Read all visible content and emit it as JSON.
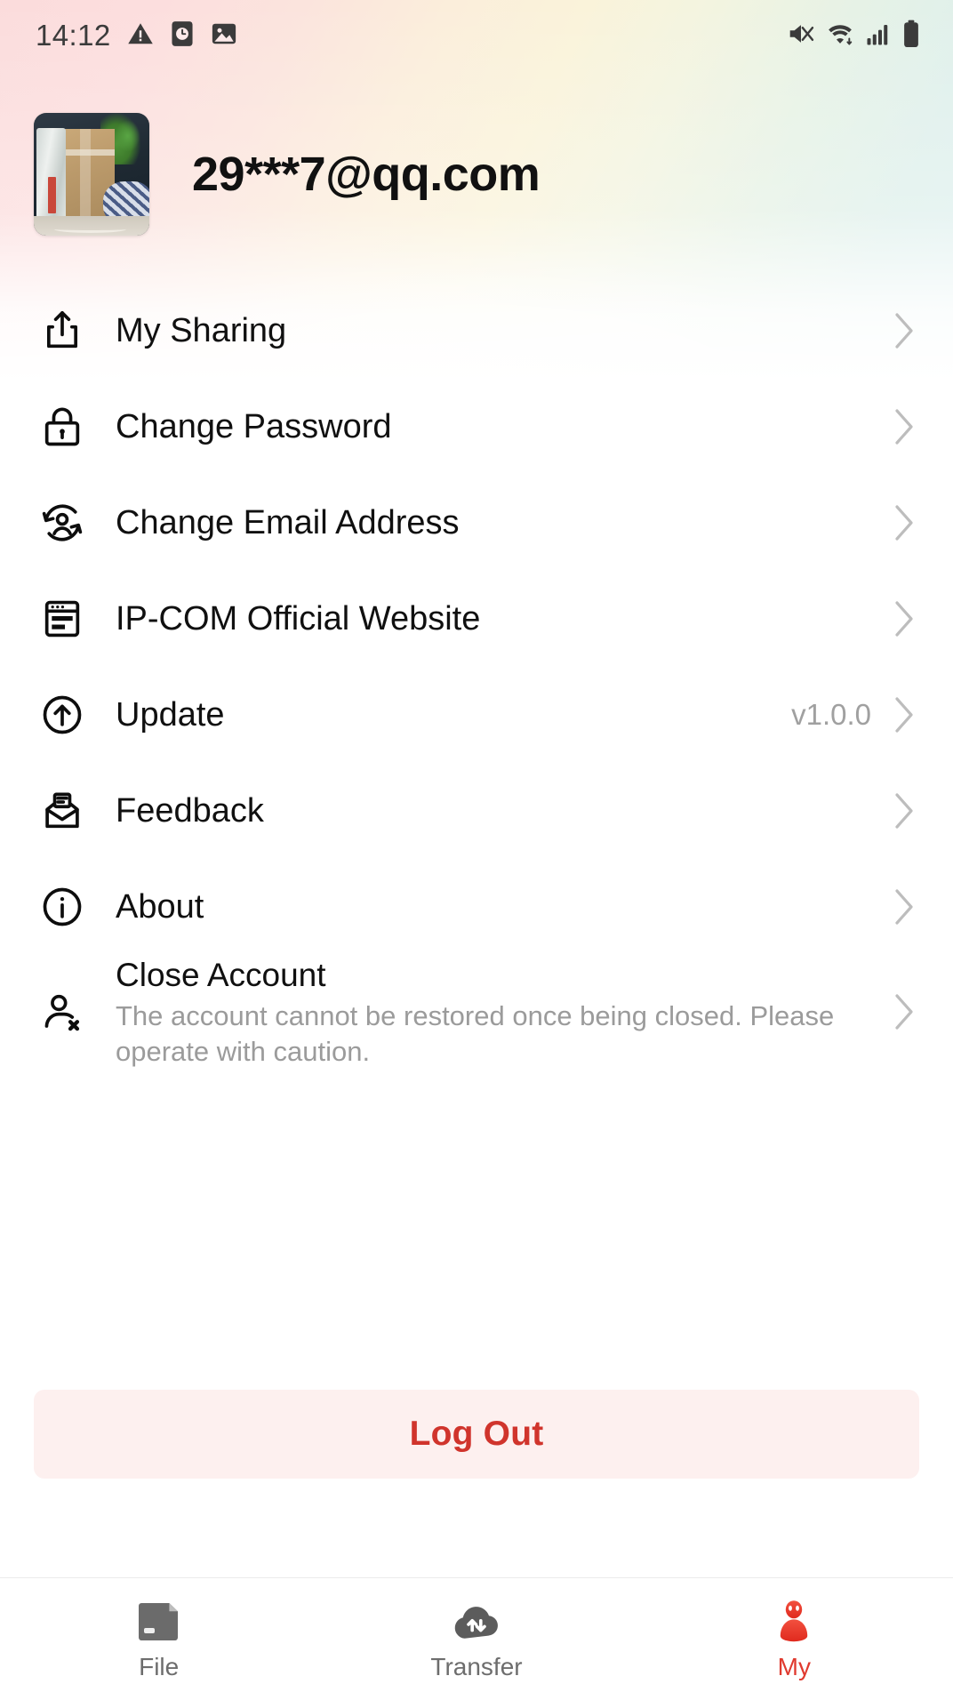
{
  "status_bar": {
    "time": "14:12",
    "left_icons": [
      "warning-triangle-icon",
      "alarm-clock-icon",
      "photo-icon"
    ],
    "right_icons": [
      "mute-vibrate-icon",
      "wifi-icon",
      "cellular-signal-icon",
      "battery-icon"
    ]
  },
  "profile": {
    "avatar_alt": "user-avatar-photo",
    "email": "29***7@qq.com"
  },
  "menu": {
    "items": [
      {
        "icon": "share-icon",
        "label": "My Sharing",
        "sub": "",
        "value": "",
        "chevron": true
      },
      {
        "icon": "lock-icon",
        "label": "Change Password",
        "sub": "",
        "value": "",
        "chevron": true
      },
      {
        "icon": "switch-account-icon",
        "label": "Change Email Address",
        "sub": "",
        "value": "",
        "chevron": true
      },
      {
        "icon": "browser-window-icon",
        "label": "IP-COM Official Website",
        "sub": "",
        "value": "",
        "chevron": true
      },
      {
        "icon": "update-arrow-icon",
        "label": "Update",
        "sub": "",
        "value": "v1.0.0",
        "chevron": true
      },
      {
        "icon": "envelope-open-icon",
        "label": "Feedback",
        "sub": "",
        "value": "",
        "chevron": true
      },
      {
        "icon": "info-circle-icon",
        "label": "About",
        "sub": "",
        "value": "",
        "chevron": true
      },
      {
        "icon": "remove-user-icon",
        "label": "Close Account",
        "sub": "The account cannot be restored once being closed. Please operate with caution.",
        "value": "",
        "chevron": true
      }
    ]
  },
  "logout": {
    "label": "Log Out",
    "text_color": "#d0342c",
    "background_color": "#fdf0ef"
  },
  "tabbar": {
    "active_color": "#e03a2f",
    "inactive_color": "#6d6d6d",
    "tabs": [
      {
        "icon": "folder-icon",
        "label": "File",
        "active": false
      },
      {
        "icon": "cloud-transfer-icon",
        "label": "Transfer",
        "active": false
      },
      {
        "icon": "person-icon",
        "label": "My",
        "active": true
      }
    ]
  },
  "theme": {
    "gradient_pink": "#fbdcdc",
    "gradient_cream": "#faf3da",
    "gradient_mint": "#dff0ec"
  }
}
